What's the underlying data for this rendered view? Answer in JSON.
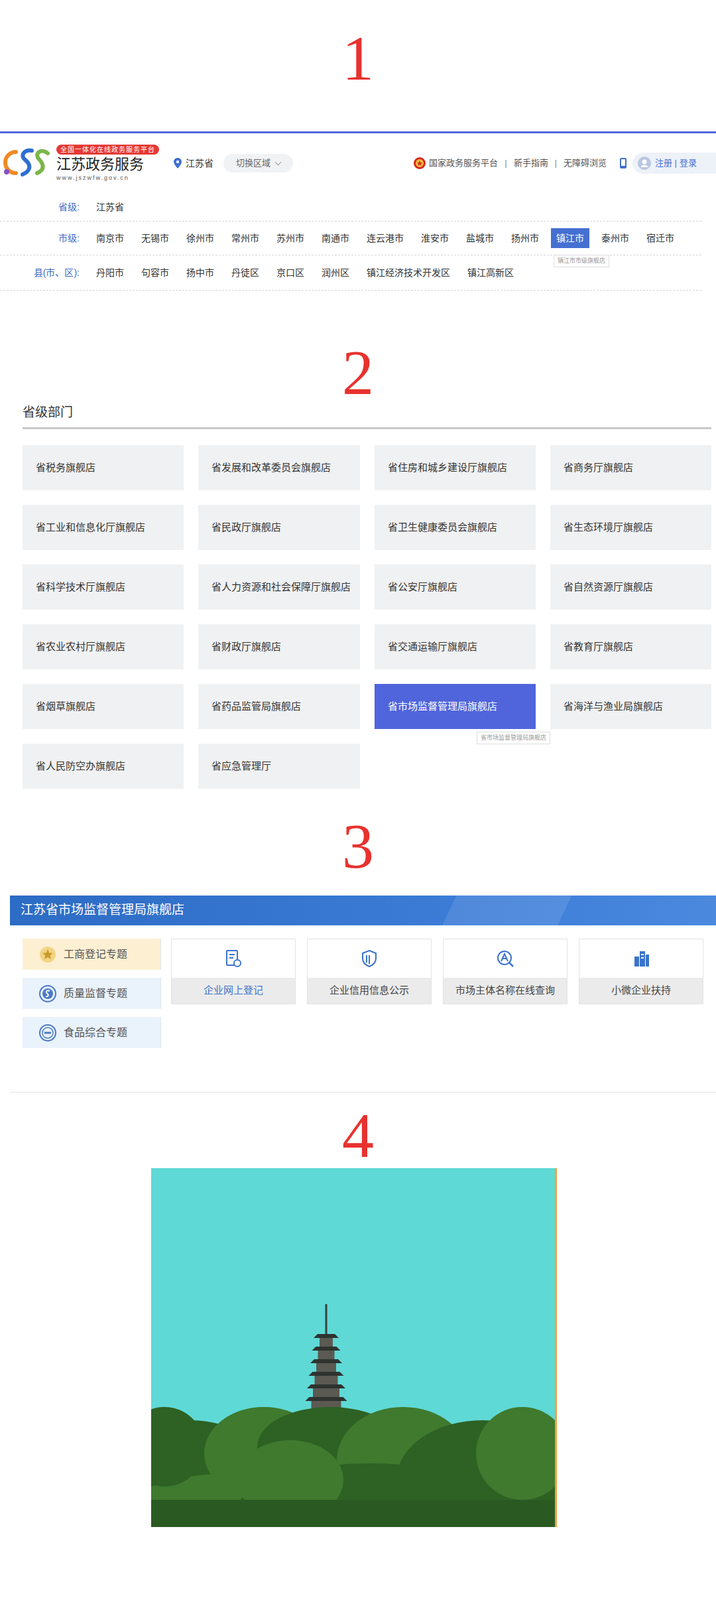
{
  "section_numbers": [
    "1",
    "2",
    "3",
    "4"
  ],
  "portal": {
    "badge": "全国一体化在线政务服务平台",
    "title": "江苏政务服务",
    "url": "www.jszwfw.gov.cn",
    "region": "江苏省",
    "switch_region": "切换区域",
    "links": [
      "国家政务服务平台",
      "新手指南",
      "无障碍浏览"
    ],
    "separator": "|",
    "account": "注册 | 登录"
  },
  "region_levels": [
    {
      "label": "省级:",
      "tooltip": "",
      "items": [
        {
          "label": "江苏省",
          "selected": false
        }
      ]
    },
    {
      "label": "市级:",
      "tooltip": "镇江市市级旗舰店",
      "items": [
        {
          "label": "南京市",
          "selected": false
        },
        {
          "label": "无锡市",
          "selected": false
        },
        {
          "label": "徐州市",
          "selected": false
        },
        {
          "label": "常州市",
          "selected": false
        },
        {
          "label": "苏州市",
          "selected": false
        },
        {
          "label": "南通市",
          "selected": false
        },
        {
          "label": "连云港市",
          "selected": false
        },
        {
          "label": "淮安市",
          "selected": false
        },
        {
          "label": "盐城市",
          "selected": false
        },
        {
          "label": "扬州市",
          "selected": false
        },
        {
          "label": "镇江市",
          "selected": true
        },
        {
          "label": "泰州市",
          "selected": false
        },
        {
          "label": "宿迁市",
          "selected": false
        }
      ]
    },
    {
      "label": "县(市、区):",
      "tooltip": "",
      "items": [
        {
          "label": "丹阳市",
          "selected": false
        },
        {
          "label": "句容市",
          "selected": false
        },
        {
          "label": "扬中市",
          "selected": false
        },
        {
          "label": "丹徒区",
          "selected": false
        },
        {
          "label": "京口区",
          "selected": false
        },
        {
          "label": "润州区",
          "selected": false
        },
        {
          "label": "镇江经济技术开发区",
          "selected": false
        },
        {
          "label": "镇江高新区",
          "selected": false
        }
      ]
    }
  ],
  "departments": {
    "title": "省级部门",
    "tooltip": "省市场监督管理局旗舰店",
    "items": [
      {
        "label": "省税务旗舰店",
        "selected": false
      },
      {
        "label": "省发展和改革委员会旗舰店",
        "selected": false
      },
      {
        "label": "省住房和城乡建设厅旗舰店",
        "selected": false
      },
      {
        "label": "省商务厅旗舰店",
        "selected": false
      },
      {
        "label": "省工业和信息化厅旗舰店",
        "selected": false
      },
      {
        "label": "省民政厅旗舰店",
        "selected": false
      },
      {
        "label": "省卫生健康委员会旗舰店",
        "selected": false
      },
      {
        "label": "省生态环境厅旗舰店",
        "selected": false
      },
      {
        "label": "省科学技术厅旗舰店",
        "selected": false
      },
      {
        "label": "省人力资源和社会保障厅旗舰店",
        "selected": false
      },
      {
        "label": "省公安厅旗舰店",
        "selected": false
      },
      {
        "label": "省自然资源厅旗舰店",
        "selected": false
      },
      {
        "label": "省农业农村厅旗舰店",
        "selected": false
      },
      {
        "label": "省财政厅旗舰店",
        "selected": false
      },
      {
        "label": "省交通运输厅旗舰店",
        "selected": false
      },
      {
        "label": "省教育厅旗舰店",
        "selected": false
      },
      {
        "label": "省烟草旗舰店",
        "selected": false
      },
      {
        "label": "省药品监管局旗舰店",
        "selected": false
      },
      {
        "label": "省市场监督管理局旗舰店",
        "selected": true
      },
      {
        "label": "省海洋与渔业局旗舰店",
        "selected": false
      },
      {
        "label": "省人民防空办旗舰店",
        "selected": false
      },
      {
        "label": "省应急管理厅",
        "selected": false
      }
    ]
  },
  "flagship": {
    "title": "江苏省市场监督管理局旗舰店",
    "topics": [
      {
        "label": "工商登记专题",
        "selected": true
      },
      {
        "label": "质量监督专题",
        "selected": false
      },
      {
        "label": "食品综合专题",
        "selected": false
      }
    ],
    "services": [
      {
        "label": "企业网上登记",
        "selected": true
      },
      {
        "label": "企业信用信息公示",
        "selected": false
      },
      {
        "label": "市场主体名称在线查询",
        "selected": false
      },
      {
        "label": "小微企业扶持",
        "selected": false
      }
    ]
  }
}
